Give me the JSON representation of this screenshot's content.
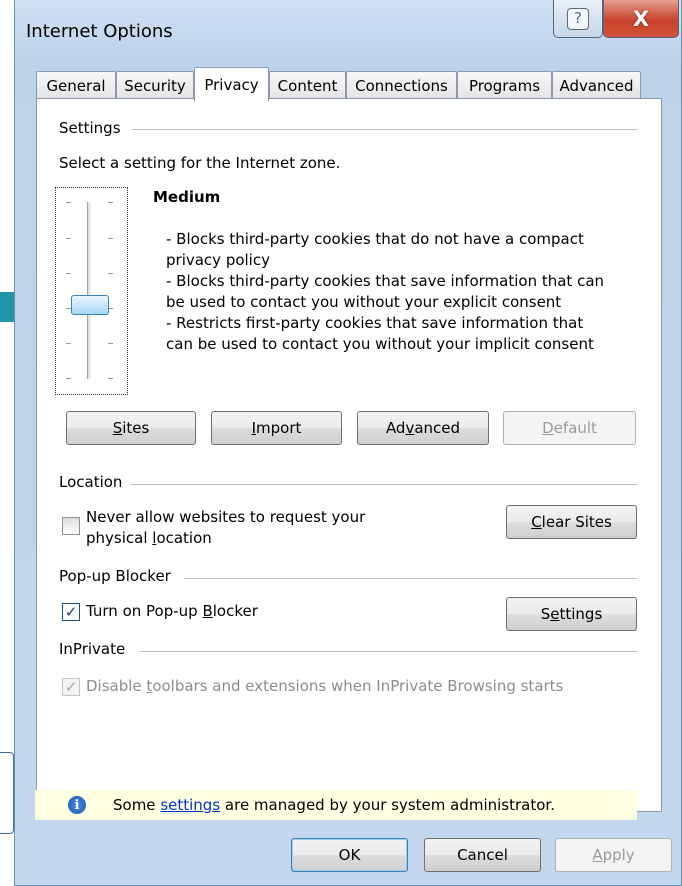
{
  "window": {
    "title": "Internet Options",
    "help_label": "?",
    "close_label": "X"
  },
  "tabs": [
    {
      "label": "General",
      "active": false
    },
    {
      "label": "Security",
      "active": false
    },
    {
      "label": "Privacy",
      "active": true
    },
    {
      "label": "Content",
      "active": false
    },
    {
      "label": "Connections",
      "active": false
    },
    {
      "label": "Programs",
      "active": false
    },
    {
      "label": "Advanced",
      "active": false
    }
  ],
  "settings": {
    "group_label": "Settings",
    "zone_prompt": "Select a setting for the Internet zone.",
    "level": "Medium",
    "description": [
      "- Blocks third-party cookies that do not have a compact",
      "privacy policy",
      "- Blocks third-party cookies that save information that can",
      "be used to contact you without your explicit consent",
      "- Restricts first-party cookies that save information that",
      "can be used to contact you without your implicit consent"
    ],
    "buttons": {
      "sites": {
        "pre": "",
        "key": "S",
        "post": "ites"
      },
      "import": {
        "pre": "",
        "key": "I",
        "post": "mport"
      },
      "advanced": {
        "pre": "Ad",
        "key": "v",
        "post": "anced"
      },
      "default": {
        "pre": "",
        "key": "D",
        "post": "efault",
        "disabled": true
      }
    }
  },
  "location": {
    "group_label": "Location",
    "checkbox_line1": "Never allow websites to request your",
    "checkbox_line2_pre": "physical ",
    "checkbox_line2_key": "l",
    "checkbox_line2_post": "ocation",
    "checked": false,
    "clear_sites": {
      "pre": "",
      "key": "C",
      "post": "lear Sites"
    }
  },
  "popup": {
    "group_label": "Pop-up Blocker",
    "checkbox_pre": "Turn on Pop-up ",
    "checkbox_key": "B",
    "checkbox_post": "locker",
    "checked": true,
    "settings": {
      "pre": "S",
      "key": "e",
      "post": "ttings"
    }
  },
  "inprivate": {
    "group_label": "InPrivate",
    "checkbox_pre": "Disable ",
    "checkbox_key": "t",
    "checkbox_post": "oolbars and extensions when InPrivate Browsing starts",
    "checked": true,
    "disabled": true
  },
  "infobar": {
    "pre": "Some ",
    "link": "settings",
    "post": " are managed by your system administrator."
  },
  "footer": {
    "ok": "OK",
    "cancel": "Cancel",
    "apply": {
      "pre": "",
      "key": "A",
      "post": "pply",
      "disabled": true
    }
  },
  "colors": {
    "accent_arrow": "#1f97a8",
    "title_bar": "#c4d8ef",
    "infobar_bg": "#ffffe1",
    "close_red": "#c7422c"
  }
}
